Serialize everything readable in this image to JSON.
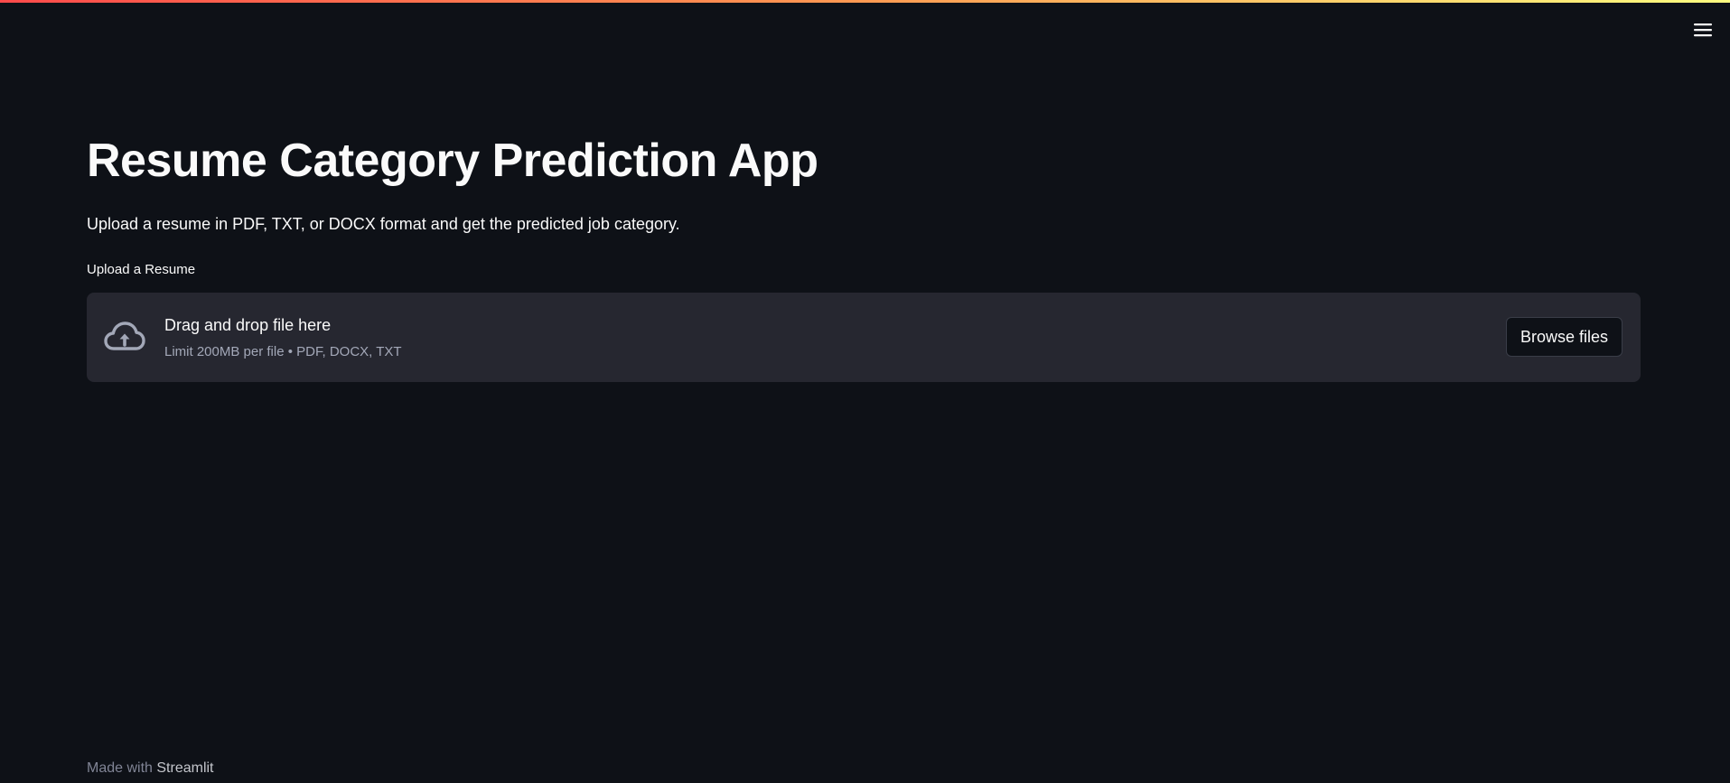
{
  "theme": {
    "background": "#0e1117",
    "text": "#fafafa",
    "dropzone_background": "#262730",
    "muted_text": "#a3a8b8",
    "accent_gradient": [
      "#ff4b4b",
      "#fffd80"
    ]
  },
  "header": {
    "menu_icon": "hamburger-menu-icon"
  },
  "main": {
    "title": "Resume Category Prediction App",
    "subtitle": "Upload a resume in PDF, TXT, or DOCX format and get the predicted job category.",
    "uploader": {
      "label": "Upload a Resume",
      "icon": "cloud-upload-icon",
      "drop_text": "Drag and drop file here",
      "limit_text": "Limit 200MB per file • PDF, DOCX, TXT",
      "browse_label": "Browse files"
    }
  },
  "footer": {
    "prefix": "Made with",
    "link_text": "Streamlit"
  }
}
